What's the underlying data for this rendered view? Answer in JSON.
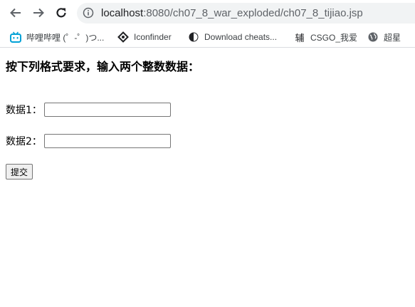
{
  "browser": {
    "url_host": "localhost",
    "url_rest": ":8080/ch07_8_war_exploded/ch07_8_tijiao.jsp",
    "bookmarks": [
      {
        "label": "哔哩哔哩 (゜-゜)つ...",
        "icon": "bilibili-icon"
      },
      {
        "label": "Iconfinder",
        "icon": "iconfinder-icon"
      },
      {
        "label": "Download cheats...",
        "icon": "half-moon-icon"
      },
      {
        "label": "CSGO_我爱",
        "icon": "fu-icon"
      },
      {
        "label": "超星",
        "icon": "globe-icon"
      }
    ]
  },
  "page": {
    "heading": "按下列格式要求，输入两个整数数据：",
    "field1_label": "数据1：",
    "field1_value": "",
    "field2_label": "数据2：",
    "field2_value": "",
    "submit_label": "提交"
  },
  "colors": {
    "omnibox_bg": "#f1f3f4",
    "bilibili": "#00a1d6"
  }
}
